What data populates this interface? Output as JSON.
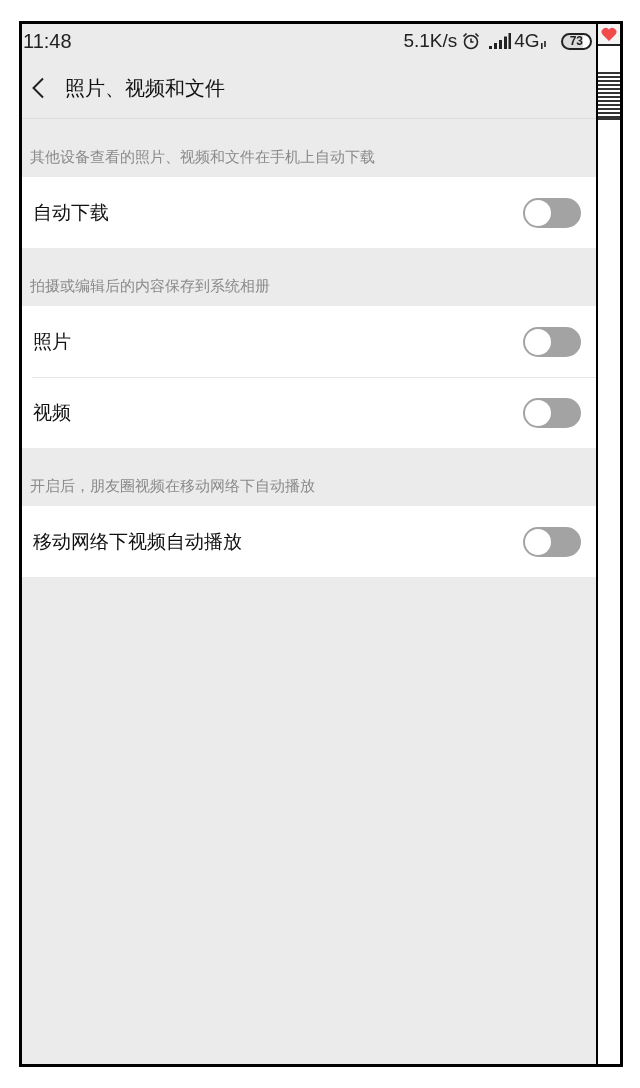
{
  "status_bar": {
    "time": "11:48",
    "network_speed": "5.1K/s",
    "network_type": "4G",
    "battery": "73"
  },
  "header": {
    "title": "照片、视频和文件"
  },
  "sections": [
    {
      "caption": "其他设备查看的照片、视频和文件在手机上自动下载",
      "items": [
        {
          "label": "自动下载",
          "on": false
        }
      ]
    },
    {
      "caption": "拍摄或编辑后的内容保存到系统相册",
      "items": [
        {
          "label": "照片",
          "on": false
        },
        {
          "label": "视频",
          "on": false
        }
      ]
    },
    {
      "caption": "开启后，朋友圈视频在移动网络下自动播放",
      "items": [
        {
          "label": "移动网络下视频自动播放",
          "on": false
        }
      ]
    }
  ]
}
